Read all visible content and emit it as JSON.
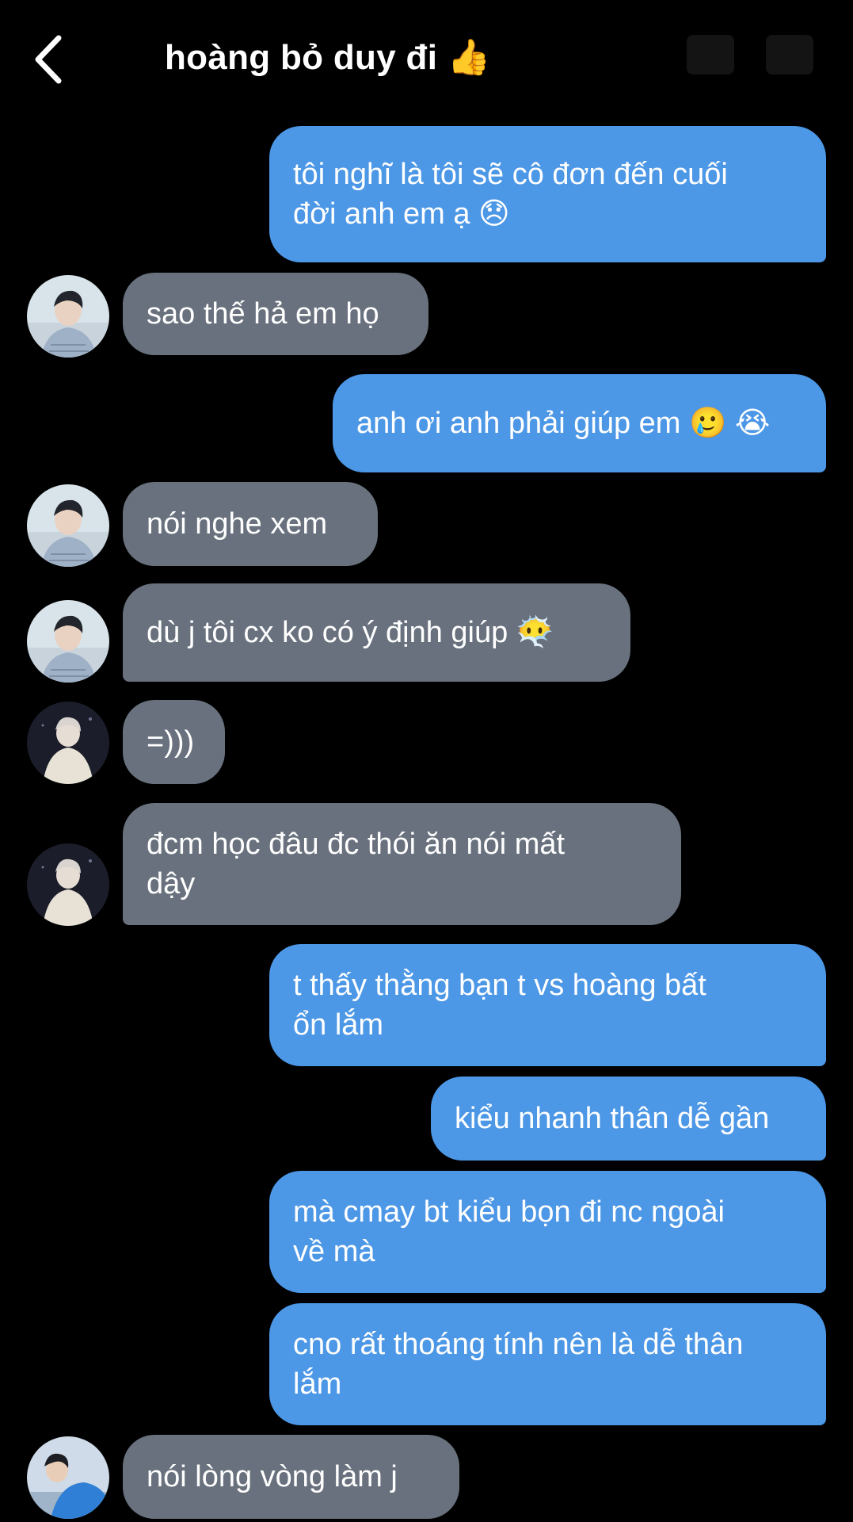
{
  "header": {
    "title": "hoàng bỏ duy đi 👍"
  },
  "messages": [
    {
      "side": "out",
      "text": "tôi nghĩ là tôi sẽ cô đơn đến cuối\nđời anh em ạ 😞"
    },
    {
      "side": "in",
      "text": "sao thế hả em họ",
      "avatar": "avatar-a"
    },
    {
      "side": "out",
      "text": "anh ơi anh phải giúp em 🥲 😭"
    },
    {
      "side": "in",
      "text": "nói nghe xem",
      "avatar": "avatar-a"
    },
    {
      "side": "in",
      "text": "dù j tôi cx ko có ý định giúp 😶‍🌫️",
      "avatar": "avatar-a"
    },
    {
      "side": "in",
      "text": "=)))",
      "avatar": "avatar-b"
    },
    {
      "side": "in",
      "text": "đcm học đâu đc thói ăn nói mất\ndậy",
      "avatar": "avatar-b"
    },
    {
      "side": "out",
      "text": "t thấy thằng bạn t vs hoàng bất\nổn lắm"
    },
    {
      "side": "out",
      "text": "kiểu nhanh thân dễ gần"
    },
    {
      "side": "out",
      "text": "mà cmay bt kiểu bọn đi nc ngoài\nvề mà"
    },
    {
      "side": "out",
      "text": "cno rất thoáng tính nên là dễ thân\nlắm"
    },
    {
      "side": "in",
      "text": "nói lòng vòng làm j",
      "avatar": "avatar-c"
    }
  ],
  "colors": {
    "background": "#000000",
    "outgoing_bubble": "#4c97e6",
    "incoming_bubble": "#68717d",
    "text": "#ffffff"
  },
  "icons": {
    "back": "chevron-left-icon"
  }
}
